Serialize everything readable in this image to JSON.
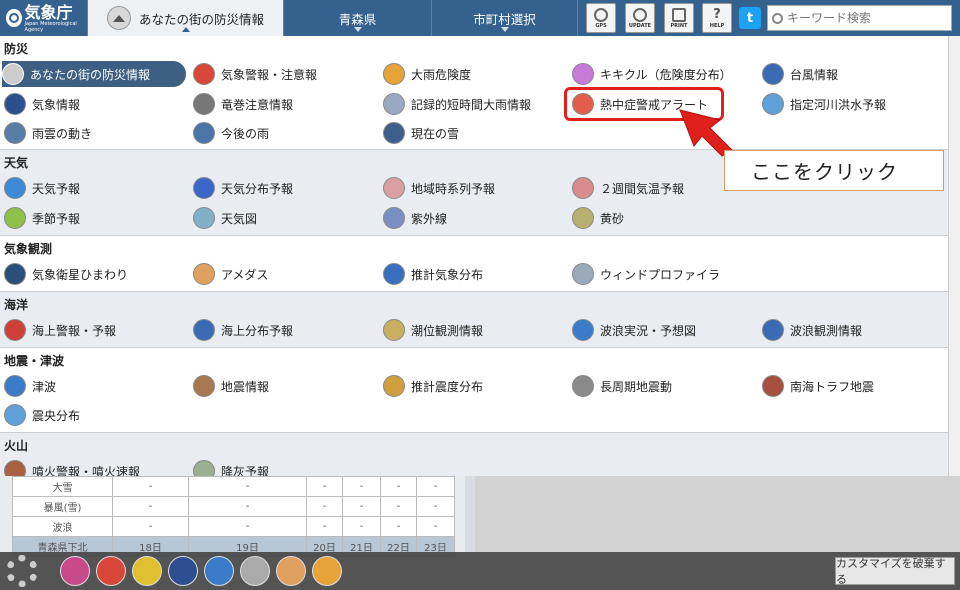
{
  "header": {
    "logo_main": "気象庁",
    "logo_sub": "Japan Meteorological Agency",
    "home_icon_label": "HOME",
    "tabs": [
      {
        "label": "あなたの街の防災情報",
        "active": true
      },
      {
        "label": "青森県",
        "active": false
      },
      {
        "label": "市町村選択",
        "active": false
      }
    ],
    "tools": [
      "GPS",
      "UPDATE",
      "PRINT",
      "HELP"
    ],
    "twitter_glyph": "t",
    "search_placeholder": "キーワード検索"
  },
  "sections": [
    {
      "title": "防災",
      "items": [
        {
          "label": "あなたの街の防災情報",
          "icon": "home-icon",
          "color": "#cccccc",
          "selected": true
        },
        {
          "label": "気象警報・注意報",
          "icon": "warning-icon",
          "color": "#d9473a"
        },
        {
          "label": "大雨危険度",
          "icon": "heavy-rain-icon",
          "color": "#e8a23a"
        },
        {
          "label": "キキクル（危険度分布）",
          "icon": "kikikuru-icon",
          "color": "#c77ad8"
        },
        {
          "label": "台風情報",
          "icon": "typhoon-icon",
          "color": "#3b6bb5"
        },
        {
          "label": "気象情報",
          "icon": "weather-info-icon",
          "color": "#2d4f8f"
        },
        {
          "label": "竜巻注意情報",
          "icon": "tornado-icon",
          "color": "#777777"
        },
        {
          "label": "記録的短時間大雨情報",
          "icon": "record-rain-icon",
          "color": "#9aa9c2"
        },
        {
          "label": "熱中症警戒アラート",
          "icon": "thermometer-icon",
          "color": "#e35d4a"
        },
        {
          "label": "指定河川洪水予報",
          "icon": "river-icon",
          "color": "#5fa0d8"
        },
        {
          "label": "雨雲の動き",
          "icon": "rain-cloud-icon",
          "color": "#567ea7"
        },
        {
          "label": "今後の雨",
          "icon": "future-rain-icon",
          "color": "#4b75a8"
        },
        {
          "label": "現在の雪",
          "icon": "snow-icon",
          "color": "#3d5f8c"
        }
      ]
    },
    {
      "title": "天気",
      "items": [
        {
          "label": "天気予報",
          "icon": "forecast-icon",
          "color": "#3c8ad8"
        },
        {
          "label": "天気分布予報",
          "icon": "distribution-icon",
          "color": "#3b67c8"
        },
        {
          "label": "地域時系列予報",
          "icon": "timeseries-icon",
          "color": "#d8a0a0"
        },
        {
          "label": "２週間気温予報",
          "icon": "temperature-chart-icon",
          "color": "#d98a8a"
        },
        {
          "label": "季節予報",
          "icon": "season-icon",
          "color": "#8fc04c"
        },
        {
          "label": "天気図",
          "icon": "weather-map-icon",
          "color": "#7fb0c8"
        },
        {
          "label": "紫外線",
          "icon": "uv-icon",
          "color": "#7a8fc4"
        },
        {
          "label": "黄砂",
          "icon": "yellow-sand-icon",
          "color": "#b8b070"
        }
      ]
    },
    {
      "title": "気象観測",
      "items": [
        {
          "label": "気象衛星ひまわり",
          "icon": "satellite-icon",
          "color": "#2a4f7a"
        },
        {
          "label": "アメダス",
          "icon": "amedas-icon",
          "color": "#e0a060"
        },
        {
          "label": "推計気象分布",
          "icon": "estimated-weather-icon",
          "color": "#3a6fc0"
        },
        {
          "label": "ウィンドプロファイラ",
          "icon": "wind-profiler-icon",
          "color": "#9aaabb"
        }
      ]
    },
    {
      "title": "海洋",
      "items": [
        {
          "label": "海上警報・予報",
          "icon": "marine-warning-icon",
          "color": "#d0403a"
        },
        {
          "label": "海上分布予報",
          "icon": "marine-distribution-icon",
          "color": "#3b6bb5"
        },
        {
          "label": "潮位観測情報",
          "icon": "tide-icon",
          "color": "#c8b060"
        },
        {
          "label": "波浪実況・予想図",
          "icon": "wave-map-icon",
          "color": "#3b7cc8"
        },
        {
          "label": "波浪観測情報",
          "icon": "wave-observation-icon",
          "color": "#3b6bb5"
        }
      ]
    },
    {
      "title": "地震・津波",
      "items": [
        {
          "label": "津波",
          "icon": "tsunami-icon",
          "color": "#3b7cc8"
        },
        {
          "label": "地震情報",
          "icon": "earthquake-icon",
          "color": "#a87850"
        },
        {
          "label": "推計震度分布",
          "icon": "seismic-intensity-icon",
          "color": "#d0a040"
        },
        {
          "label": "長周期地震動",
          "icon": "long-period-icon",
          "color": "#8a8a8a"
        },
        {
          "label": "南海トラフ地震",
          "icon": "nankai-trough-icon",
          "color": "#a85040"
        },
        {
          "label": "震央分布",
          "icon": "epicenter-icon",
          "color": "#5fa0d8"
        }
      ]
    },
    {
      "title": "火山",
      "items": [
        {
          "label": "噴火警報・噴火速報",
          "icon": "volcano-icon",
          "color": "#a86040"
        },
        {
          "label": "降灰予報",
          "icon": "ashfall-icon",
          "color": "#9ab090"
        }
      ]
    }
  ],
  "background_table": {
    "rows": [
      [
        "大雪",
        "-",
        "-",
        "-",
        "-",
        "-",
        "-"
      ],
      [
        "暴風(雪)",
        "-",
        "-",
        "-",
        "-",
        "-",
        "-"
      ],
      [
        "波浪",
        "-",
        "-",
        "-",
        "-",
        "-",
        "-"
      ],
      [
        "青森県下北",
        "18日",
        "19日",
        "20日",
        "21日",
        "22日",
        "23日"
      ]
    ]
  },
  "bottombar": {
    "quick_icons": [
      {
        "icon": "grid-icon",
        "color": "#c84a8a"
      },
      {
        "icon": "warning-icon",
        "color": "#d9473a"
      },
      {
        "icon": "caution-icon",
        "color": "#e0c030"
      },
      {
        "icon": "weather-info-icon",
        "color": "#2d4f8f"
      },
      {
        "icon": "info-icon",
        "color": "#3b7cc8"
      },
      {
        "icon": "tornado-icon",
        "color": "#aaaaaa"
      },
      {
        "icon": "amedas-icon",
        "color": "#e0a060"
      },
      {
        "icon": "heavy-rain-icon",
        "color": "#e8a23a"
      }
    ],
    "customize_label": "カスタマイズを破棄する"
  },
  "annotation": {
    "callout_text": "ここをクリック",
    "highlight_color": "#e0201b"
  }
}
